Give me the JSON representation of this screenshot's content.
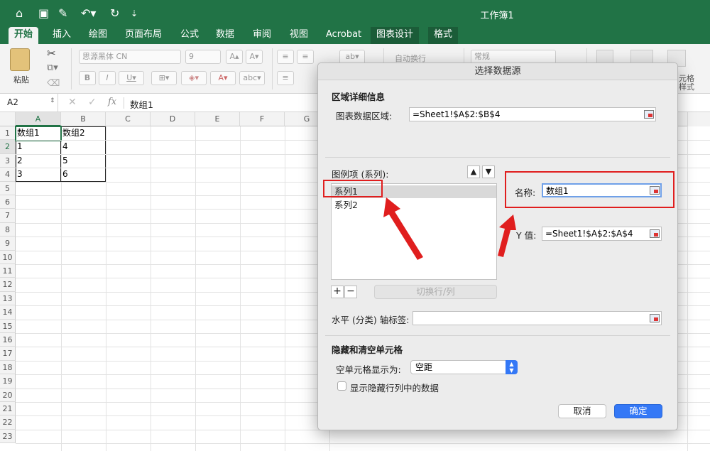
{
  "window": {
    "title": "工作簿1"
  },
  "tabs": [
    "开始",
    "插入",
    "绘图",
    "页面布局",
    "公式",
    "数据",
    "审阅",
    "视图",
    "Acrobat",
    "图表设计",
    "格式"
  ],
  "ribbon": {
    "paste_label": "粘贴",
    "font_name": "思源黑体 CN",
    "font_size": "9",
    "wrap_text": "自动换行",
    "number_format": "常规",
    "cell_style_label_1": "元格",
    "cell_style_label_2": "样式"
  },
  "formula_bar": {
    "cell_ref": "A2",
    "fx": "fx",
    "content": "数组1"
  },
  "sheet": {
    "columns": [
      "A",
      "B",
      "C",
      "D",
      "E",
      "F",
      "G"
    ],
    "rows": [
      "1",
      "2",
      "3",
      "4",
      "5",
      "6",
      "7",
      "8",
      "9",
      "10",
      "11",
      "12",
      "13",
      "14",
      "15",
      "16",
      "17",
      "18",
      "19",
      "20",
      "21",
      "22",
      "23"
    ],
    "cells": [
      [
        "数组1",
        "数组2"
      ],
      [
        "1",
        "4"
      ],
      [
        "2",
        "5"
      ],
      [
        "3",
        "6"
      ]
    ]
  },
  "dialog": {
    "title": "选择数据源",
    "section_range": "区域详细信息",
    "chart_range_label": "图表数据区域:",
    "chart_range_value": "=Sheet1!$A$2:$B$4",
    "legend_label": "图例项 (系列):",
    "series": [
      "系列1",
      "系列2"
    ],
    "switch_button": "切换行/列",
    "name_label": "名称:",
    "name_value": "数组1",
    "y_label": "Y 值:",
    "y_value": "=Sheet1!$A$2:$A$4",
    "axis_label": "水平 (分类) 轴标签:",
    "axis_value": "",
    "section_hidden": "隐藏和清空单元格",
    "empty_cells_label": "空单元格显示为:",
    "empty_cells_value": "空距",
    "show_hidden_label": "显示隐藏行列中的数据",
    "cancel": "取消",
    "ok": "确定"
  },
  "colors": {
    "excel_green": "#217346",
    "highlight_red": "#e01e1e",
    "ok_blue": "#3478f6"
  }
}
